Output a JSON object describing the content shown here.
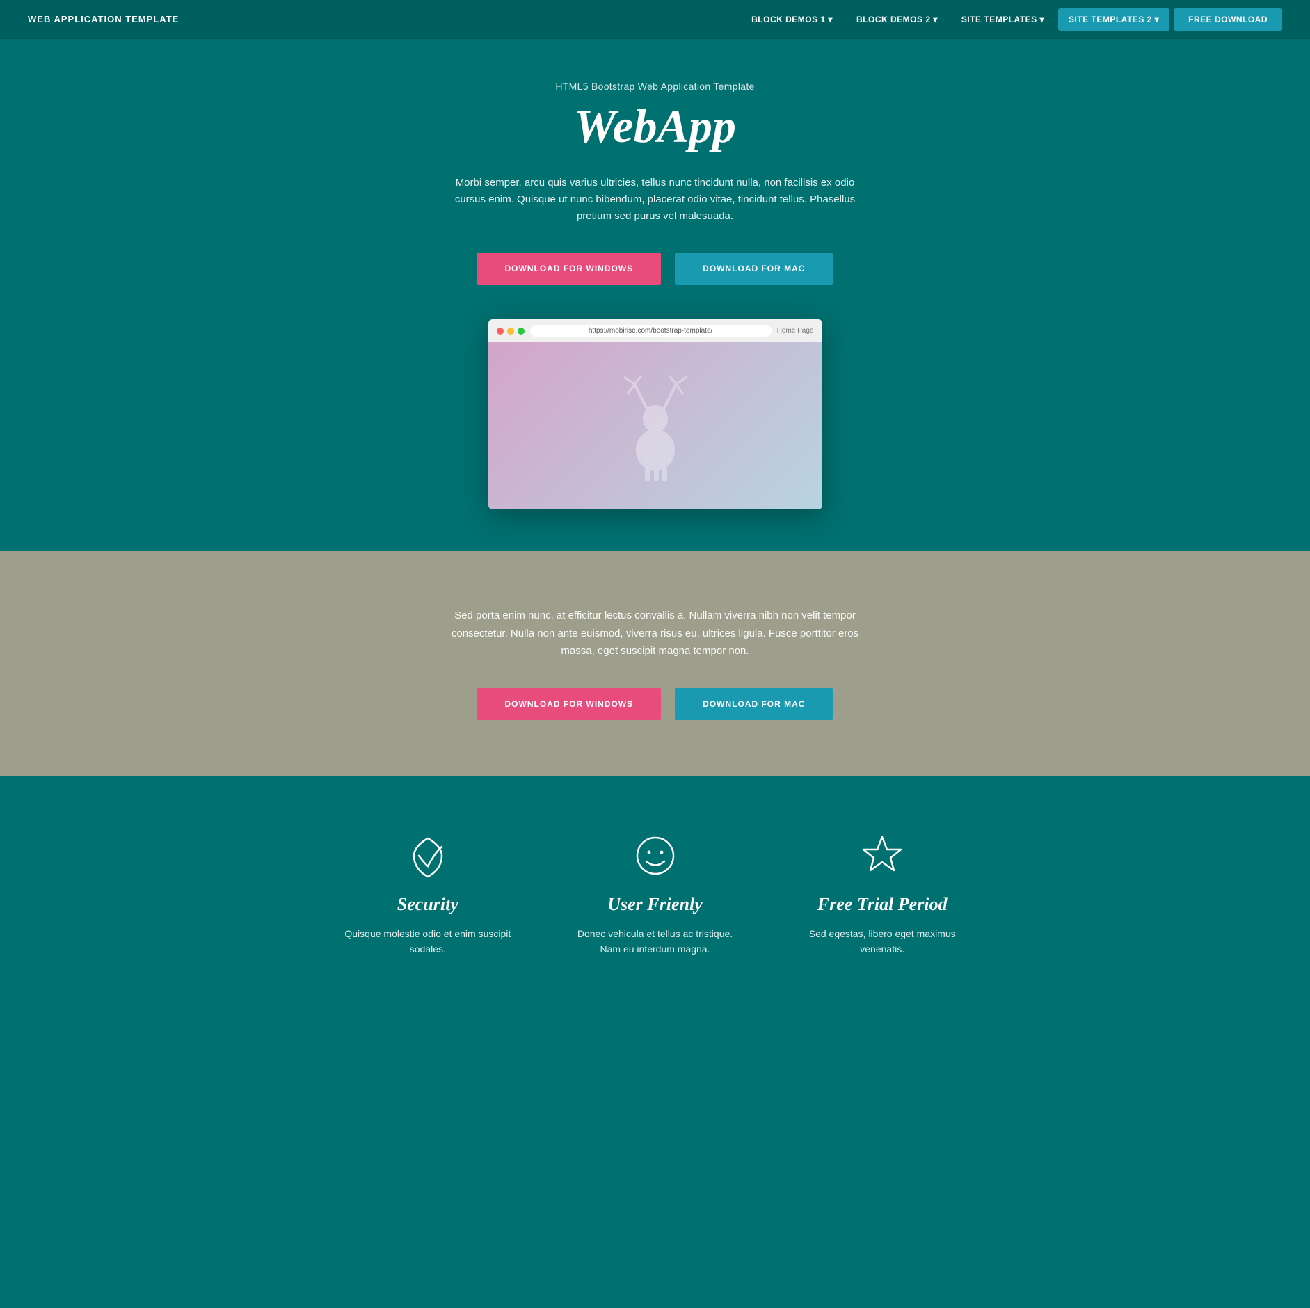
{
  "nav": {
    "brand": "WEB APPLICATION TEMPLATE",
    "links": [
      {
        "label": "BLOCK DEMOS 1 ▾",
        "active": false
      },
      {
        "label": "BLOCK DEMOS 2 ▾",
        "active": false
      },
      {
        "label": "SITE TEMPLATES ▾",
        "active": false
      },
      {
        "label": "SITE TEMPLATES 2 ▾",
        "active": true
      },
      {
        "label": "FREE DOWNLOAD",
        "primary": true
      }
    ]
  },
  "hero": {
    "subtitle": "HTML5 Bootstrap Web Application Template",
    "title": "WebApp",
    "description": "Morbi semper, arcu quis varius ultricies, tellus nunc tincidunt nulla, non facilisis ex odio cursus enim. Quisque ut nunc bibendum, placerat odio vitae, tincidunt tellus. Phasellus pretium sed purus vel malesuada.",
    "btn_windows": "DOWNLOAD FOR WINDOWS",
    "btn_mac": "DOWNLOAD FOR MAC",
    "browser_url": "https://mobirise.com/bootstrap-template/",
    "browser_home": "Home Page"
  },
  "section2": {
    "description": "Sed porta enim nunc, at efficitur lectus convallis a. Nullam viverra nibh non velit tempor consectetur. Nulla non ante euismod, viverra risus eu, ultrices ligula. Fusce porttitor eros massa, eget suscipit magna tempor non.",
    "btn_windows": "DOWNLOAD FOR WINDOWS",
    "btn_mac": "DOWNLOAD FOR MAC"
  },
  "features": [
    {
      "icon": "heart",
      "title": "Security",
      "description": "Quisque molestie odio et enim suscipit sodales."
    },
    {
      "icon": "smiley",
      "title": "User Frienly",
      "description": "Donec vehicula et tellus ac tristique. Nam eu interdum magna."
    },
    {
      "icon": "star",
      "title": "Free Trial Period",
      "description": "Sed egestas, libero eget maximus venenatis."
    }
  ]
}
